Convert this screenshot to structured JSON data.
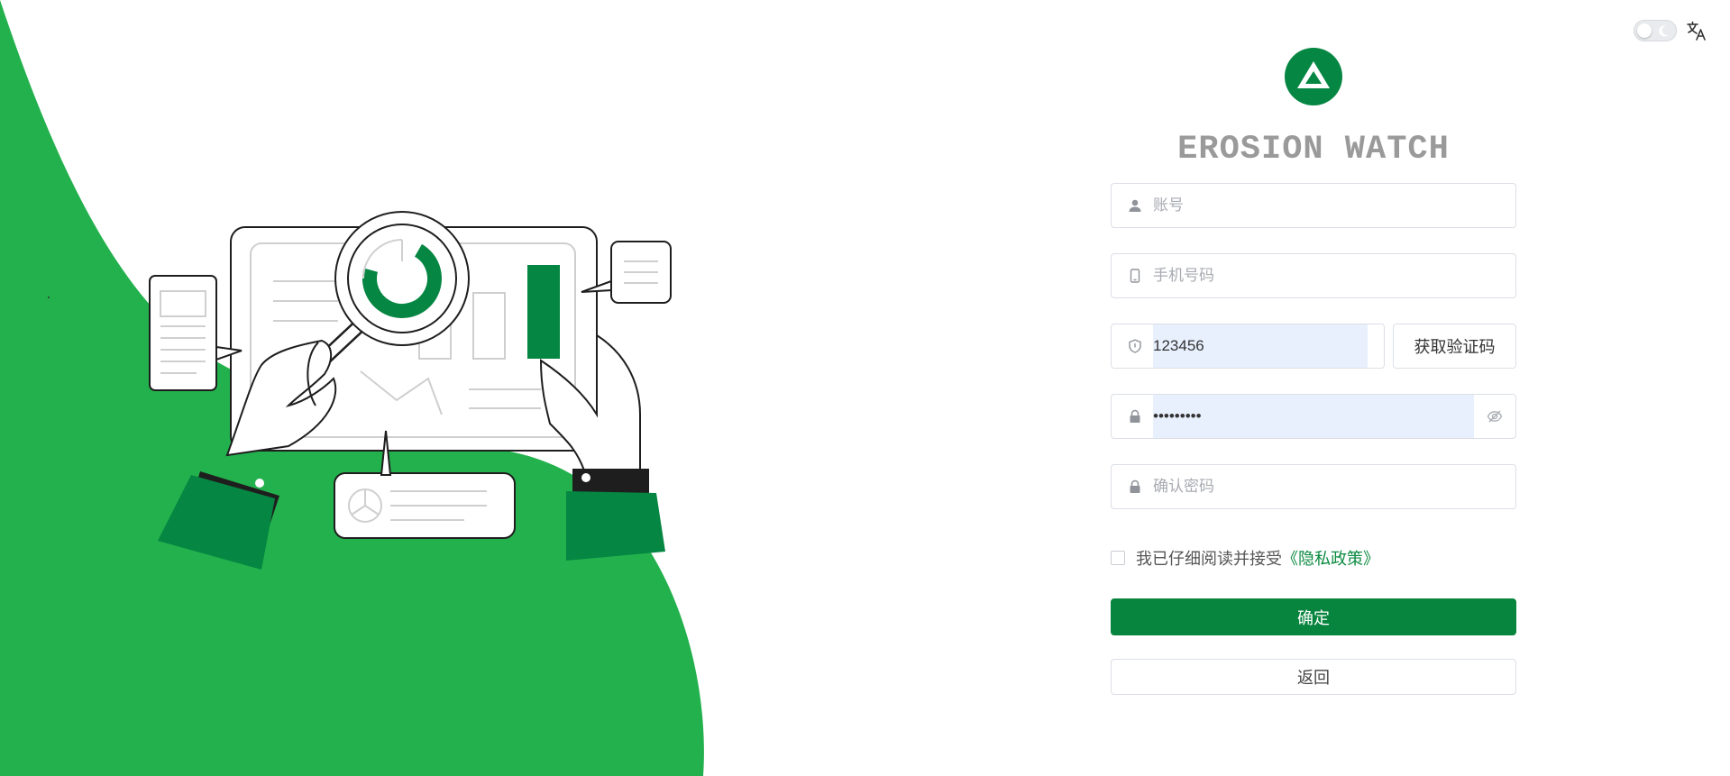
{
  "brand": {
    "title": "EROSION WATCH"
  },
  "topbar": {
    "theme_toggle": "theme-toggle",
    "language_icon": "translate-icon"
  },
  "form": {
    "account": {
      "placeholder": "账号",
      "value": ""
    },
    "phone": {
      "placeholder": "手机号码",
      "value": ""
    },
    "code": {
      "value": "123456",
      "button_label": "获取验证码"
    },
    "password": {
      "value": "•••••••••"
    },
    "confirm_password": {
      "placeholder": "确认密码",
      "value": ""
    },
    "agreement": {
      "text": "我已仔细阅读并接受",
      "link": "《隐私政策》",
      "checked": false
    },
    "submit_label": "确定",
    "back_label": "返回"
  },
  "colors": {
    "accent": "#07843e",
    "brand_green": "#23b14d",
    "dark_green": "#058642",
    "autofill": "#e8f0fe"
  }
}
